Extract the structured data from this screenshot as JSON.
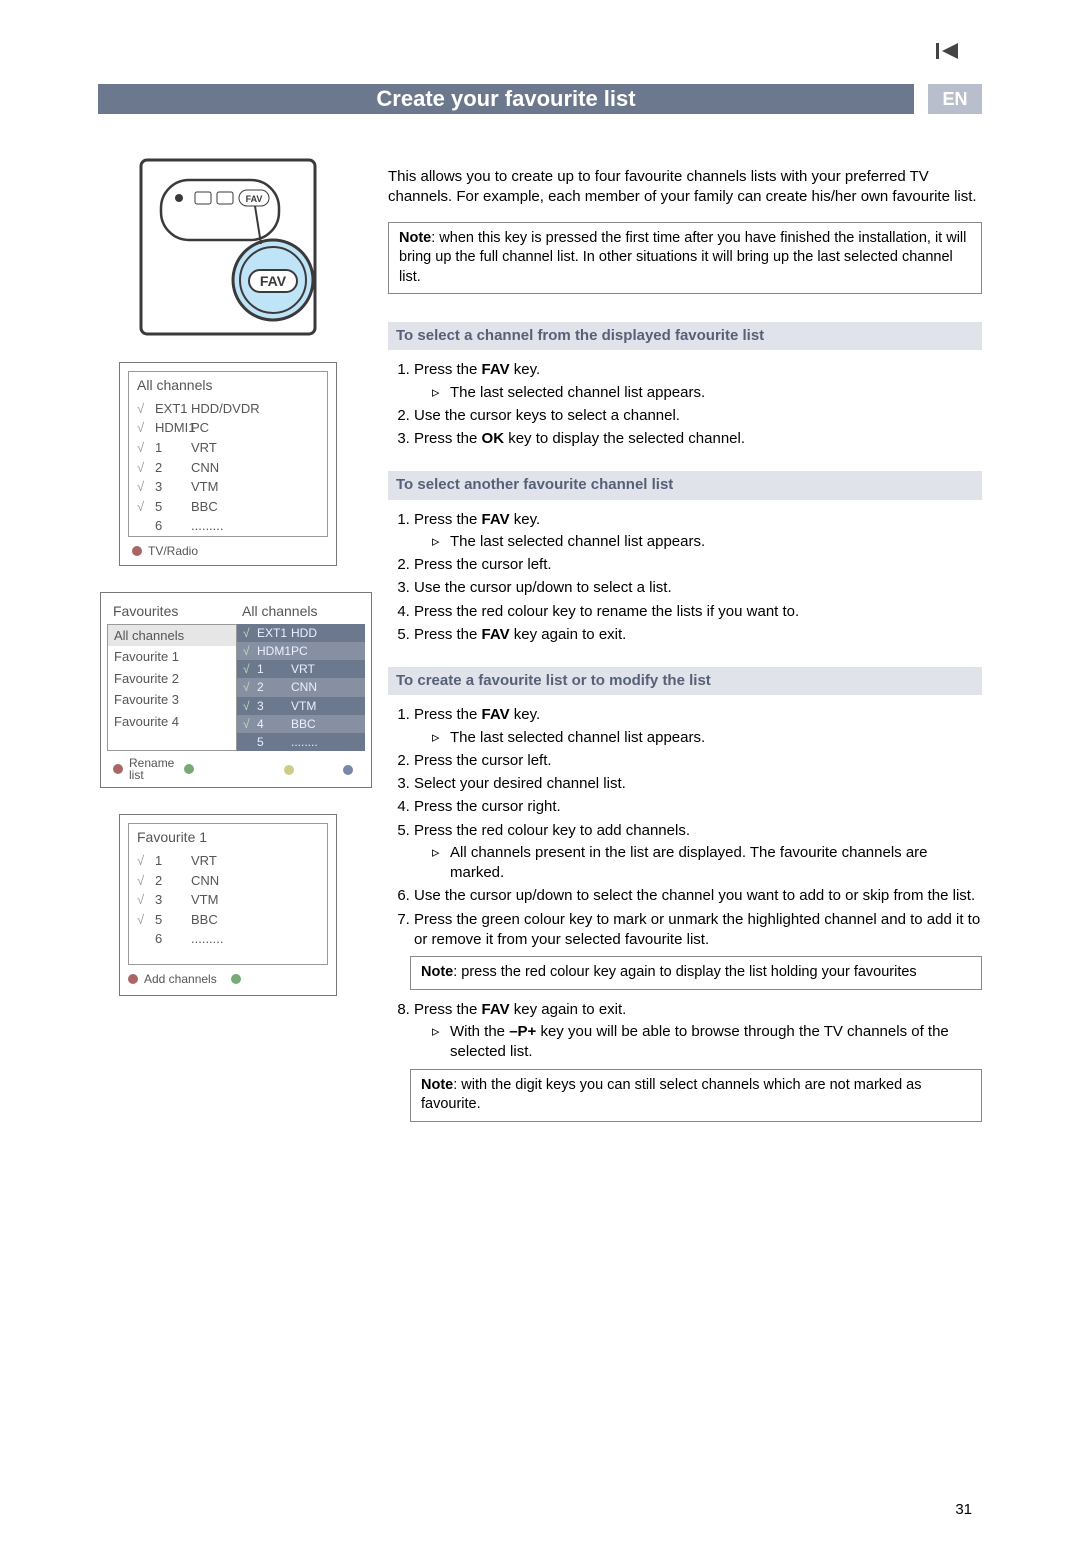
{
  "page_number": "31",
  "nav_icon": "prev-track-icon",
  "title": "Create your favourite list",
  "lang_badge": "EN",
  "remote": {
    "fav_button_label": "FAV",
    "callout_label": "FAV"
  },
  "panel_allchannels": {
    "title": "All channels",
    "rows": [
      {
        "tick": "√",
        "num": "EXT1",
        "lbl": "HDD/DVDR"
      },
      {
        "tick": "√",
        "num": "HDMI1",
        "lbl": "PC"
      },
      {
        "tick": "√",
        "num": "1",
        "lbl": "VRT"
      },
      {
        "tick": "√",
        "num": "2",
        "lbl": "CNN"
      },
      {
        "tick": "√",
        "num": "3",
        "lbl": "VTM"
      },
      {
        "tick": "√",
        "num": "5",
        "lbl": "BBC"
      },
      {
        "tick": "",
        "num": "6",
        "lbl": "........."
      }
    ],
    "footer_label": "TV/Radio"
  },
  "panel_favs": {
    "left_header": "Favourites",
    "right_header": "All channels",
    "left_items": [
      {
        "label": "All channels",
        "selected": true
      },
      {
        "label": "Favourite 1"
      },
      {
        "label": "Favourite 2"
      },
      {
        "label": "Favourite 3"
      },
      {
        "label": "Favourite 4"
      }
    ],
    "right_rows": [
      {
        "tick": "√",
        "num": "EXT1",
        "lbl": "HDD"
      },
      {
        "tick": "√",
        "num": "HDM1",
        "lbl": "PC"
      },
      {
        "tick": "√",
        "num": "1",
        "lbl": "VRT"
      },
      {
        "tick": "√",
        "num": "2",
        "lbl": "CNN"
      },
      {
        "tick": "√",
        "num": "3",
        "lbl": "VTM"
      },
      {
        "tick": "√",
        "num": "4",
        "lbl": "BBC"
      },
      {
        "tick": "",
        "num": "5",
        "lbl": "........"
      }
    ],
    "rename_line1": "Rename",
    "rename_line2": "list"
  },
  "panel_fav1": {
    "title": "Favourite 1",
    "rows": [
      {
        "tick": "√",
        "num": "1",
        "lbl": "VRT"
      },
      {
        "tick": "√",
        "num": "2",
        "lbl": "CNN"
      },
      {
        "tick": "√",
        "num": "3",
        "lbl": "VTM"
      },
      {
        "tick": "√",
        "num": "5",
        "lbl": "BBC"
      },
      {
        "tick": "",
        "num": "6",
        "lbl": "........."
      }
    ],
    "footer_label": "Add channels"
  },
  "intro": "This allows you to create up to four favourite channels lists with your preferred TV channels. For example, each member of your family can create his/her own favourite list.",
  "note1_bold": "Note",
  "note1_rest": ": when this key is pressed the first time after you have finished the installation, it will bring up the full channel list. In other situations it will bring up the last selected channel list.",
  "sec1_head": "To select a channel from the displayed favourite list",
  "sec1_step1a": "Press the ",
  "sec1_step1b": "FAV",
  "sec1_step1c": " key.",
  "sec1_step1_sub": "The last selected channel list appears.",
  "sec1_step2": "Use the cursor keys to select a channel.",
  "sec1_step3a": "Press the ",
  "sec1_step3b": "OK",
  "sec1_step3c": " key to display the selected channel.",
  "sec2_head": "To select another favourite channel list",
  "sec2_step1a": "Press the ",
  "sec2_step1b": "FAV",
  "sec2_step1c": " key.",
  "sec2_step1_sub": "The last selected channel list appears.",
  "sec2_step2": "Press the cursor left.",
  "sec2_step3": "Use the cursor up/down to select a list.",
  "sec2_step4": "Press the red colour key to rename the lists if you want to.",
  "sec2_step5a": "Press the ",
  "sec2_step5b": "FAV",
  "sec2_step5c": " key again to exit.",
  "sec3_head": "To create a favourite list or to modify the list",
  "sec3_step1a": "Press the ",
  "sec3_step1b": "FAV",
  "sec3_step1c": " key.",
  "sec3_step1_sub": "The last selected channel list appears.",
  "sec3_step2": "Press the cursor left.",
  "sec3_step3": "Select your desired channel list.",
  "sec3_step4": "Press the cursor right.",
  "sec3_step5": "Press the red colour key to add channels.",
  "sec3_step5_sub": "All channels present in the list are displayed. The favourite channels are marked.",
  "sec3_step6": "Use the cursor up/down to select the channel you want to add to or skip from the list.",
  "sec3_step7": "Press the green colour key to mark or unmark the highlighted channel and to add it to or remove it from your selected favourite list.",
  "sec3_note1_bold": "Note",
  "sec3_note1_rest": ": press the red colour key again to display the list holding your favourites",
  "sec3_step8a": "Press the ",
  "sec3_step8b": "FAV",
  "sec3_step8c": " key again to exit.",
  "sec3_step8_sub_a": "With the ",
  "sec3_step8_sub_b": "–P+",
  "sec3_step8_sub_c": " key you will be able to browse through the TV channels of the selected list.",
  "sec3_note2_bold": "Note",
  "sec3_note2_rest": ": with the digit keys you can still select channels which are not marked as favourite."
}
